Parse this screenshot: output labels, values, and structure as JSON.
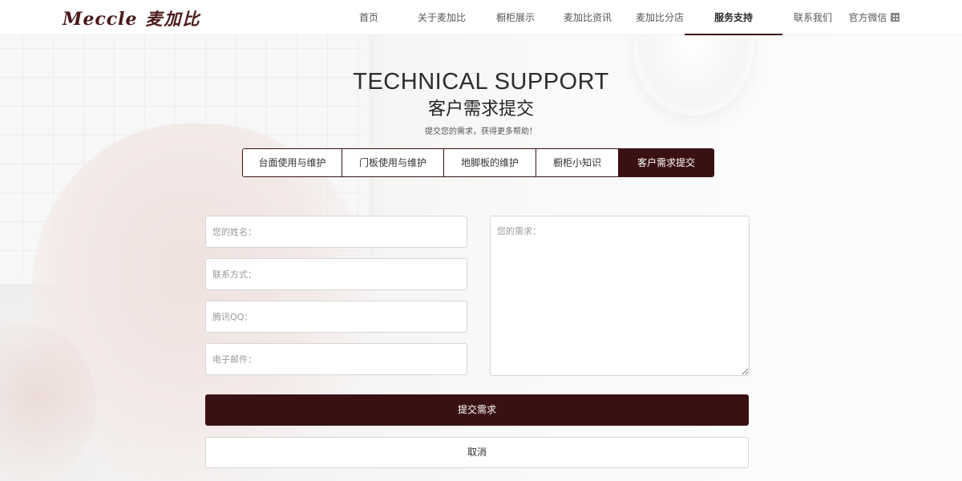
{
  "header": {
    "logo_latin": "Meccle",
    "logo_cn": "麦加比",
    "nav": [
      {
        "label": "首页"
      },
      {
        "label": "关于麦加比"
      },
      {
        "label": "橱柜展示"
      },
      {
        "label": "麦加比资讯"
      },
      {
        "label": "麦加比分店"
      },
      {
        "label": "服务支持",
        "active": true
      },
      {
        "label": "联系我们"
      },
      {
        "label": "官方微信",
        "icon": "qr-code-icon"
      }
    ]
  },
  "hero": {
    "title_en": "TECHNICAL SUPPORT",
    "title_cn": "客户需求提交",
    "subtitle": "提交您的需求，获得更多帮助！"
  },
  "tabs": [
    {
      "label": "台面使用与维护"
    },
    {
      "label": "门板使用与维护"
    },
    {
      "label": "地脚板的维护"
    },
    {
      "label": "橱柜小知识"
    },
    {
      "label": "客户需求提交",
      "active": true
    }
  ],
  "form": {
    "name_placeholder": "您的姓名：",
    "contact_placeholder": "联系方式：",
    "qq_placeholder": "腾讯QQ：",
    "email_placeholder": "电子邮件：",
    "request_placeholder": "您的需求：",
    "submit_label": "提交需求",
    "cancel_label": "取消"
  },
  "colors": {
    "accent": "#3a1112",
    "border": "#d6d6d6"
  }
}
